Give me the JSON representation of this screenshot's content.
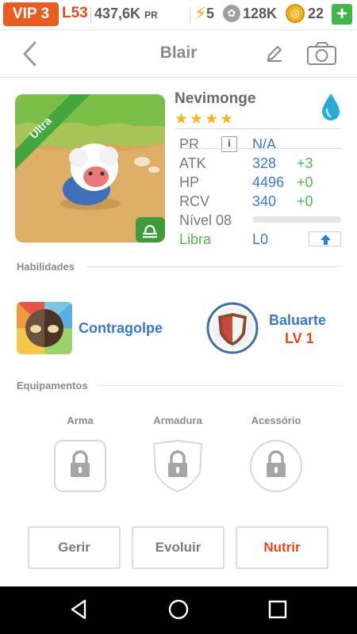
{
  "status": {
    "vip": "VIP 3",
    "level": "L53",
    "coins": "437,6K",
    "coins_unit": "PR",
    "energy": "5",
    "paws": "128K",
    "gems": "22",
    "add": "+"
  },
  "header": {
    "title": "Blair"
  },
  "pet": {
    "badge": "Ultra",
    "name": "Nevimonge",
    "stars": "★★★★",
    "stats": [
      {
        "label": "PR",
        "value": "N/A",
        "bonus": ""
      },
      {
        "label": "ATK",
        "value": "328",
        "bonus": "+3"
      },
      {
        "label": "HP",
        "value": "4496",
        "bonus": "+0"
      },
      {
        "label": "RCV",
        "value": "340",
        "bonus": "+0"
      }
    ],
    "level_label": "Nível 08",
    "level_progress": 0,
    "sign": "Libra",
    "sign_level": "L0",
    "colors": {
      "stat_value": "#3a79c9",
      "bonus": "#52b54b",
      "sign": "#52b54b"
    }
  },
  "abilities": {
    "section": "Habilidades",
    "items": [
      {
        "name": "Contragolpe",
        "level": ""
      },
      {
        "name": "Baluarte",
        "level": "LV 1"
      }
    ]
  },
  "equipment": {
    "section": "Equipamentos",
    "slots": [
      "Arma",
      "Armadura",
      "Acessório"
    ]
  },
  "actions": {
    "manage": "Gerir",
    "evolve": "Evoluir",
    "feed": "Nutrir"
  }
}
